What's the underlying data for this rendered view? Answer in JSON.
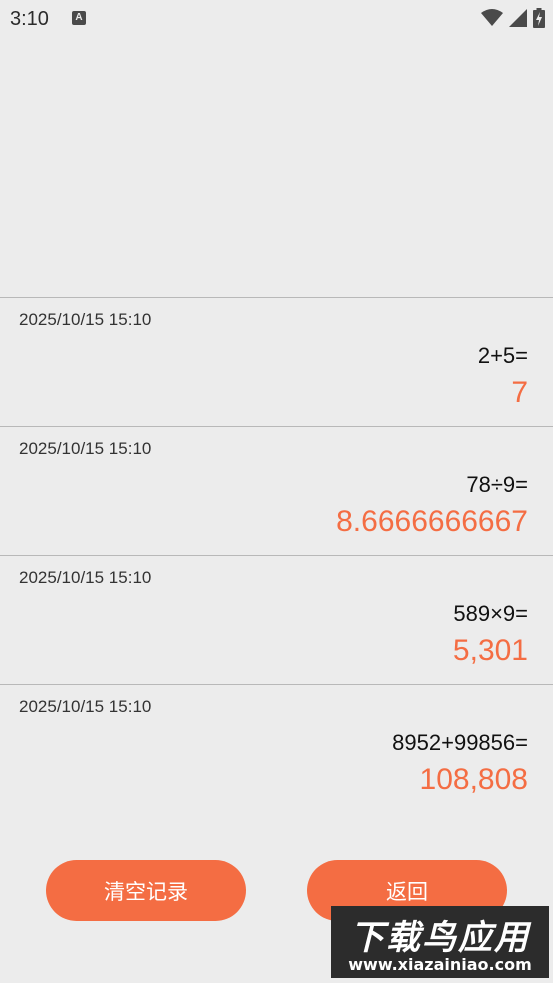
{
  "status_bar": {
    "time": "3:10",
    "notification_icon_letter": "A",
    "icons": [
      "wifi-icon",
      "signal-icon",
      "battery-icon"
    ]
  },
  "history": [
    {
      "time": "2025/10/15 15:10",
      "expression": "2+5=",
      "result": "7"
    },
    {
      "time": "2025/10/15 15:10",
      "expression": "78÷9=",
      "result": "8.6666666667"
    },
    {
      "time": "2025/10/15 15:10",
      "expression": "589×9=",
      "result": "5,301"
    },
    {
      "time": "2025/10/15 15:10",
      "expression": "8952+99856=",
      "result": "108,808"
    }
  ],
  "buttons": {
    "clear_label": "清空记录",
    "back_label": "返回"
  },
  "watermark": {
    "title": "下载鸟应用",
    "url": "www.xiazainiao.com"
  },
  "colors": {
    "accent": "#f46d43",
    "background": "#ececec"
  }
}
